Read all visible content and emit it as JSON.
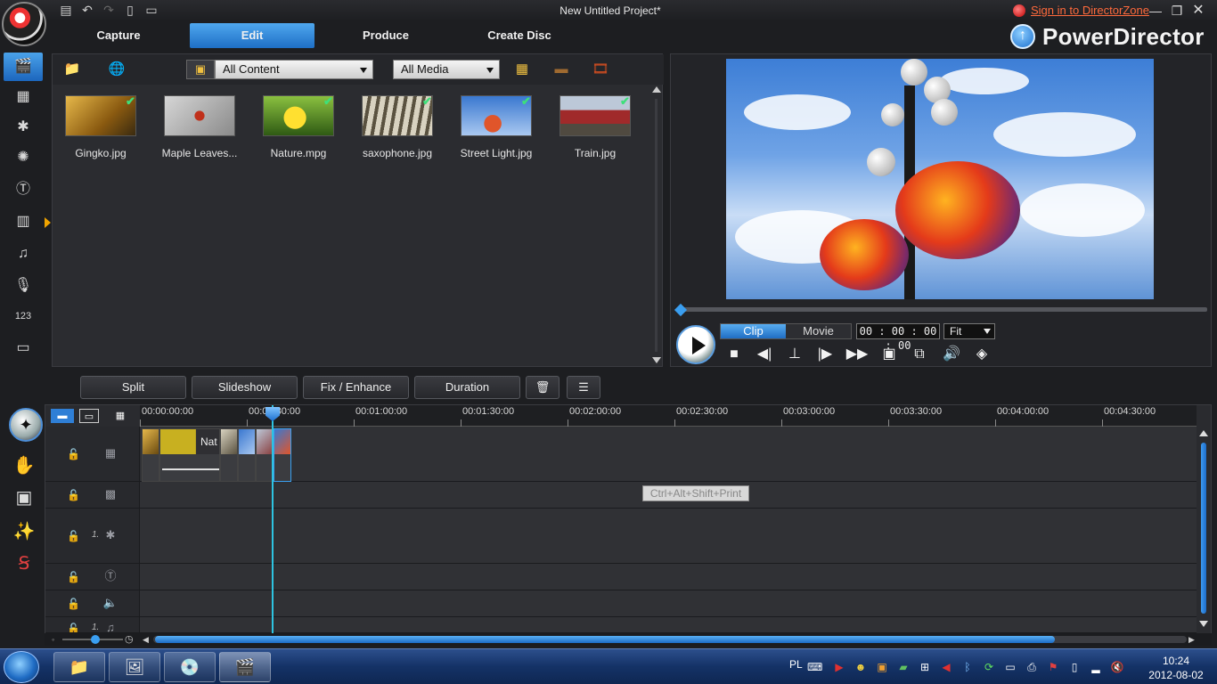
{
  "window": {
    "title": "New Untitled Project*",
    "signin_text": "Sign in to DirectorZone",
    "brand": "PowerDirector"
  },
  "modes": [
    {
      "label": "Capture",
      "active": false
    },
    {
      "label": "Edit",
      "active": true
    },
    {
      "label": "Produce",
      "active": false
    },
    {
      "label": "Create Disc",
      "active": false
    }
  ],
  "rooms": [
    {
      "icon": "media-room-icon",
      "active": true
    },
    {
      "icon": "effect-room-icon"
    },
    {
      "icon": "pip-objects-room-icon"
    },
    {
      "icon": "particle-room-icon"
    },
    {
      "icon": "title-room-icon"
    },
    {
      "icon": "transition-room-icon"
    },
    {
      "icon": "audio-mixing-room-icon"
    },
    {
      "icon": "voice-over-room-icon"
    },
    {
      "icon": "chapter-room-icon"
    },
    {
      "icon": "subtitle-room-icon"
    }
  ],
  "library": {
    "content_filter": "All Content",
    "media_filter": "All Media",
    "items": [
      {
        "label": "Gingko.jpg",
        "checked": true,
        "color": "#b07a20"
      },
      {
        "label": "Maple Leaves...",
        "checked": false,
        "color": "#9a9a9a"
      },
      {
        "label": "Nature.mpg",
        "checked": true,
        "color": "#c8b020"
      },
      {
        "label": "saxophone.jpg",
        "checked": true,
        "color": "#8a8270"
      },
      {
        "label": "Street Light.jpg",
        "checked": true,
        "color": "#4a7fd0"
      },
      {
        "label": "Train.jpg",
        "checked": true,
        "color": "#8a4040"
      }
    ]
  },
  "preview": {
    "clip_label": "Clip",
    "movie_label": "Movie",
    "active_mode": "Clip",
    "timecode": "00 : 00 : 00 : 00",
    "zoom": "Fit"
  },
  "edit_toolbar": {
    "split": "Split",
    "slideshow": "Slideshow",
    "fix_enhance": "Fix / Enhance",
    "duration": "Duration"
  },
  "timeline": {
    "ruler_labels": [
      "00:00:00:00",
      "00:00:30:00",
      "00:01:00:00",
      "00:01:30:00",
      "00:02:00:00",
      "00:02:30:00",
      "00:03:00:00",
      "00:03:30:00",
      "00:04:00:00",
      "00:04:30:00"
    ],
    "clip_text": "Nat",
    "tooltip": "Ctrl+Alt+Shift+Print",
    "tracks": [
      {
        "name": "video",
        "icon": "video-track-icon",
        "num": ""
      },
      {
        "name": "effect",
        "icon": "effect-track-icon",
        "num": ""
      },
      {
        "name": "pip",
        "icon": "pip-track-icon",
        "num": "1."
      },
      {
        "name": "title",
        "icon": "title-track-icon",
        "num": ""
      },
      {
        "name": "voice",
        "icon": "voice-track-icon",
        "num": ""
      },
      {
        "name": "music",
        "icon": "music-track-icon",
        "num": "1."
      }
    ]
  },
  "taskbar": {
    "lang": "PL",
    "time": "10:24",
    "date": "2012-08-02"
  }
}
